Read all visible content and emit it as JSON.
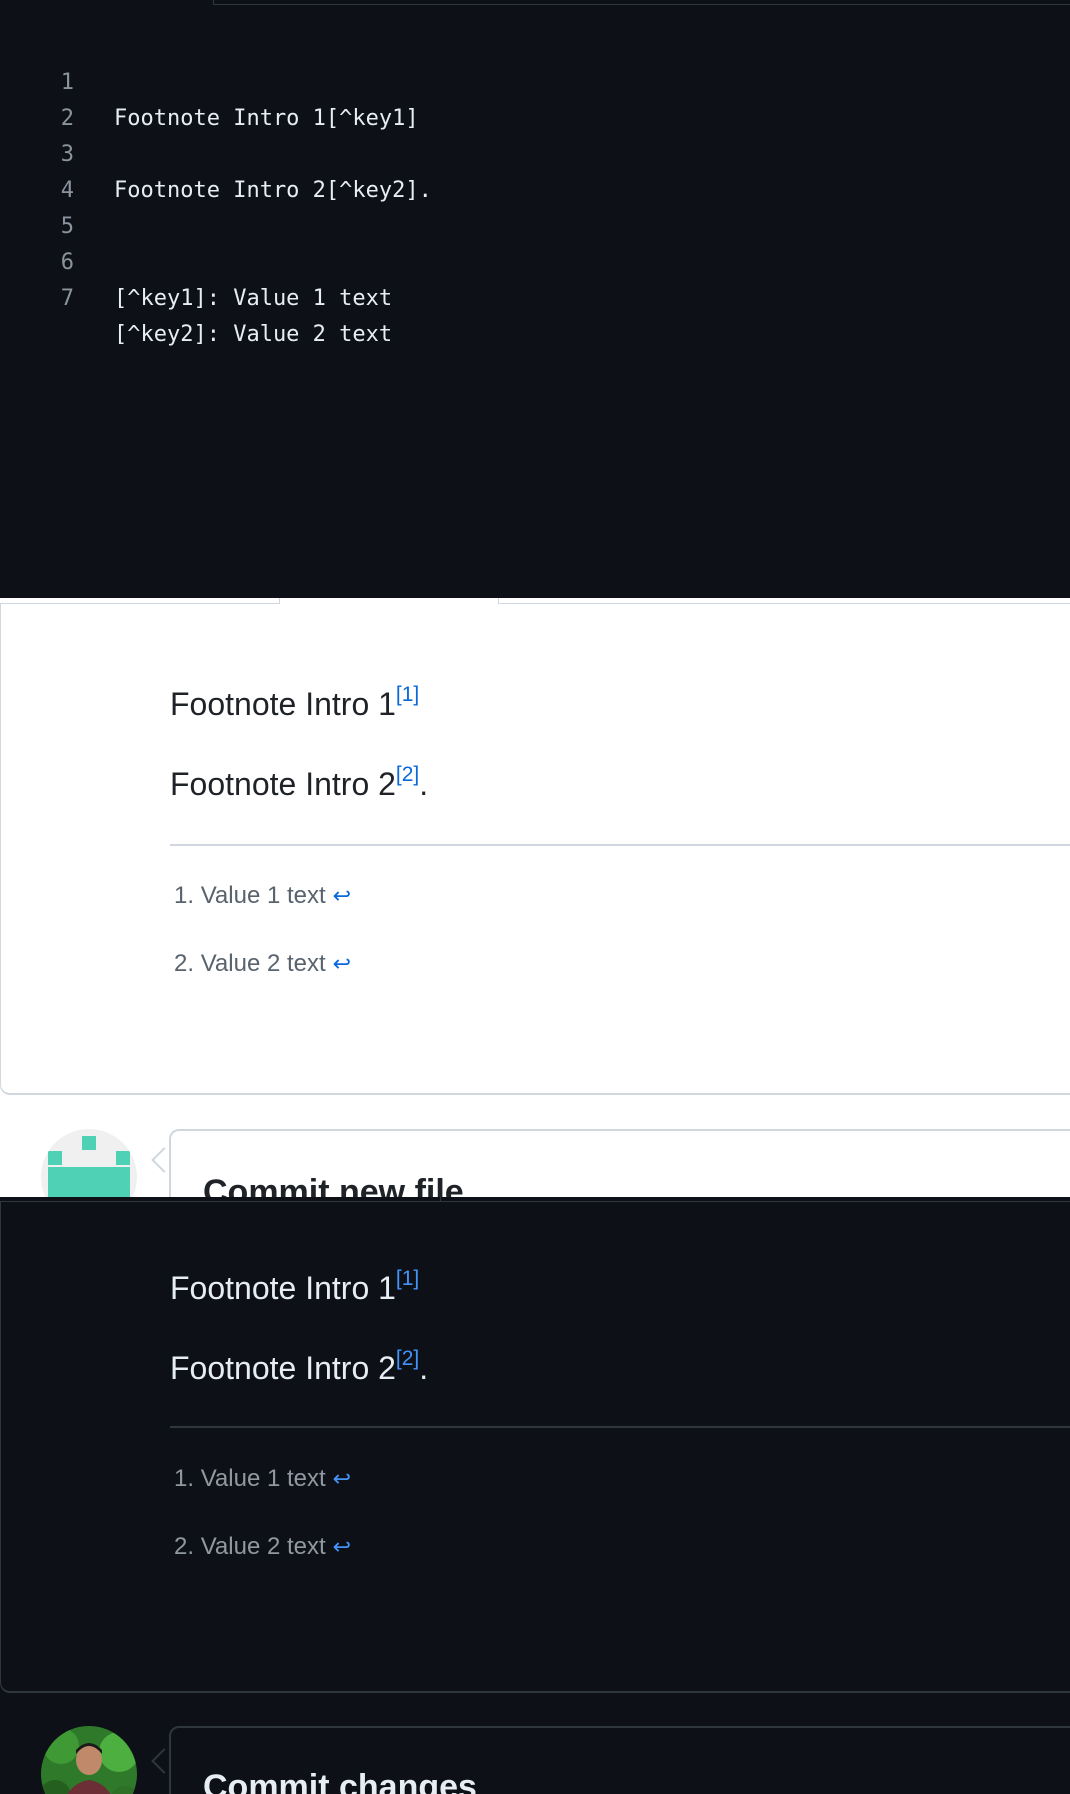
{
  "editor": {
    "lines": [
      {
        "num": "1",
        "text": "Footnote Intro 1[^key1]"
      },
      {
        "num": "2",
        "text": ""
      },
      {
        "num": "3",
        "text": "Footnote Intro 2[^key2]."
      },
      {
        "num": "4",
        "text": ""
      },
      {
        "num": "5",
        "text": ""
      },
      {
        "num": "6",
        "text": "[^key1]: Value 1 text"
      },
      {
        "num": "7",
        "text": "[^key2]: Value 2 text"
      }
    ]
  },
  "preview_light": {
    "para1": {
      "text": "Footnote Intro 1",
      "ref": "[1]"
    },
    "para2": {
      "text": "Footnote Intro 2",
      "ref": "[2]",
      "suffix": "."
    },
    "footnotes": [
      {
        "marker": "1.",
        "text": "Value 1 text",
        "backref": "↩"
      },
      {
        "marker": "2.",
        "text": "Value 2 text",
        "backref": "↩"
      }
    ],
    "commit_title": "Commit new file"
  },
  "preview_dark": {
    "para1": {
      "text": "Footnote Intro 1",
      "ref": "[1]"
    },
    "para2": {
      "text": "Footnote Intro 2",
      "ref": "[2]",
      "suffix": "."
    },
    "footnotes": [
      {
        "marker": "1.",
        "text": "Value 1 text",
        "backref": "↩"
      },
      {
        "marker": "2.",
        "text": "Value 2 text",
        "backref": "↩"
      }
    ],
    "commit_title": "Commit changes"
  },
  "colors": {
    "dark_bg": "#0d1117",
    "light_bg": "#ffffff",
    "link_light": "#0969da",
    "link_dark": "#4493f8",
    "identicon": "#4fd1b5"
  },
  "icons": {
    "backref": "return-arrow-icon",
    "avatar_light": "identicon-avatar",
    "avatar_dark": "user-photo-avatar"
  }
}
